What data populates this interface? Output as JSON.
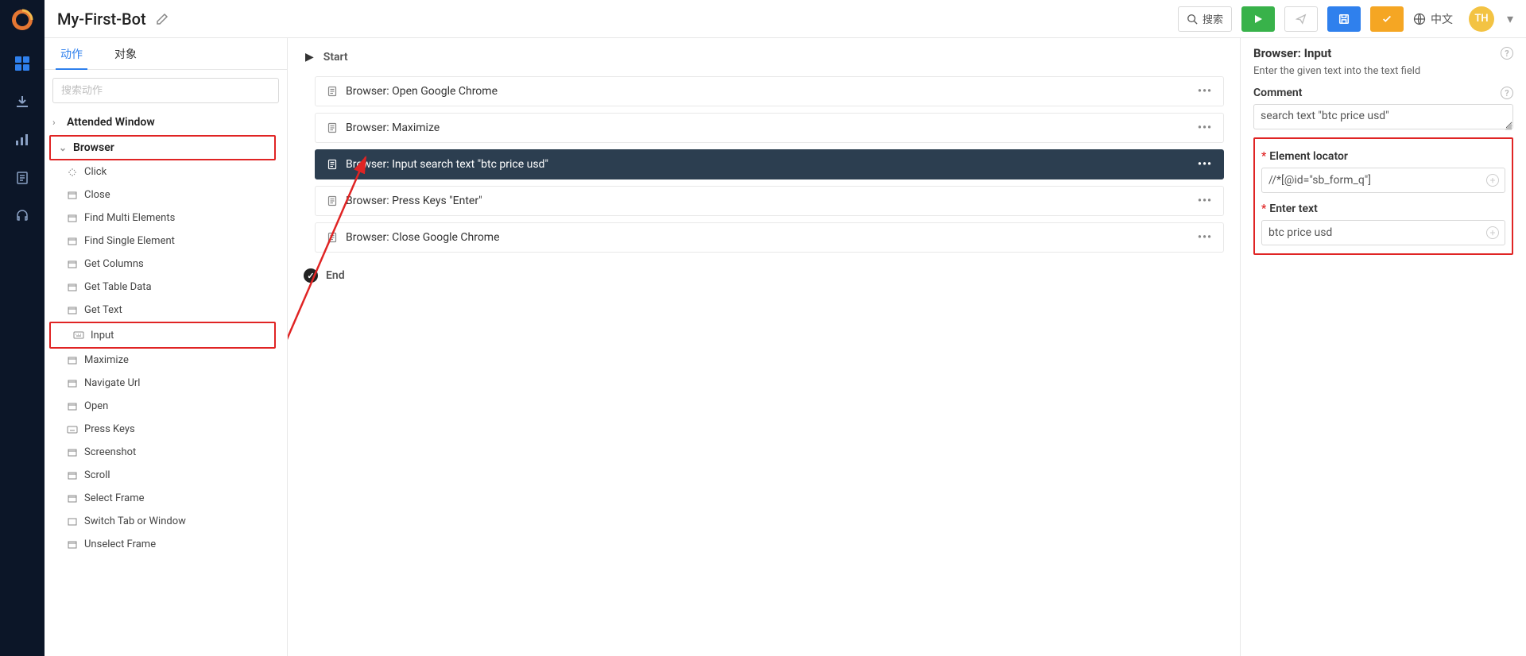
{
  "header": {
    "title": "My-First-Bot",
    "search_placeholder": "搜索",
    "lang_label": "中文",
    "avatar_initials": "TH"
  },
  "left_panel": {
    "tab_actions": "动作",
    "tab_objects": "对象",
    "search_placeholder": "搜索动作",
    "cat_attended": "Attended Window",
    "cat_browser": "Browser",
    "actions": {
      "click": "Click",
      "close": "Close",
      "find_multi": "Find Multi Elements",
      "find_single": "Find Single Element",
      "get_columns": "Get Columns",
      "get_table": "Get Table Data",
      "get_text": "Get Text",
      "input": "Input",
      "maximize": "Maximize",
      "navigate": "Navigate Url",
      "open": "Open",
      "press_keys": "Press Keys",
      "screenshot": "Screenshot",
      "scroll": "Scroll",
      "select_frame": "Select Frame",
      "switch_tab": "Switch Tab or Window",
      "unselect_frame": "Unselect Frame"
    }
  },
  "flow": {
    "start": "Start",
    "end": "End",
    "steps": {
      "s1": "Browser: Open Google Chrome",
      "s2": "Browser: Maximize",
      "s3": "Browser: Input search text \"btc price usd\"",
      "s4": "Browser: Press Keys \"Enter\"",
      "s5": "Browser: Close Google Chrome"
    }
  },
  "props": {
    "title": "Browser: Input",
    "desc": "Enter the given text into the text field",
    "comment_label": "Comment",
    "comment_value": "search text \"btc price usd\"",
    "locator_label": "Element locator",
    "locator_value": "//*[@id=\"sb_form_q\"]",
    "text_label": "Enter text",
    "text_value": "btc price usd"
  }
}
